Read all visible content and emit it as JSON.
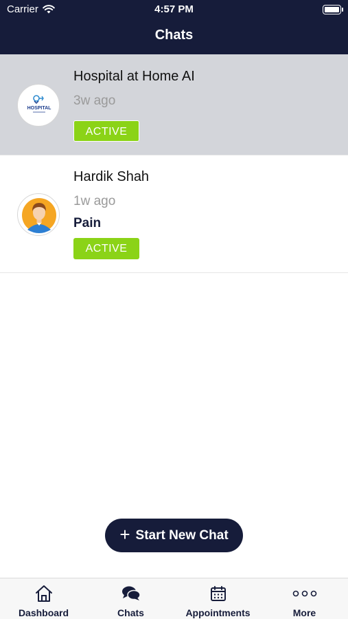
{
  "status_bar": {
    "carrier": "Carrier",
    "time": "4:57 PM"
  },
  "header": {
    "title": "Chats"
  },
  "chats": [
    {
      "name": "Hospital at Home AI",
      "time": "3w ago",
      "subtitle": "",
      "status": "ACTIVE",
      "avatar_icon": "hospital-logo-icon",
      "logo_text": "HOSPITAL",
      "selected": true
    },
    {
      "name": "Hardik Shah",
      "time": "1w ago",
      "subtitle": "Pain",
      "status": "ACTIVE",
      "avatar_icon": "person-avatar-icon",
      "selected": false
    }
  ],
  "start_button": {
    "label": "Start New Chat"
  },
  "tabbar": {
    "tabs": [
      {
        "label": "Dashboard",
        "icon": "home-icon"
      },
      {
        "label": "Chats",
        "icon": "chat-bubbles-icon"
      },
      {
        "label": "Appointments",
        "icon": "calendar-icon"
      },
      {
        "label": "More",
        "icon": "more-dots-icon"
      }
    ]
  },
  "colors": {
    "header_bg": "#161c3a",
    "active_badge": "#8bd317",
    "selected_row": "#d3d5da"
  }
}
